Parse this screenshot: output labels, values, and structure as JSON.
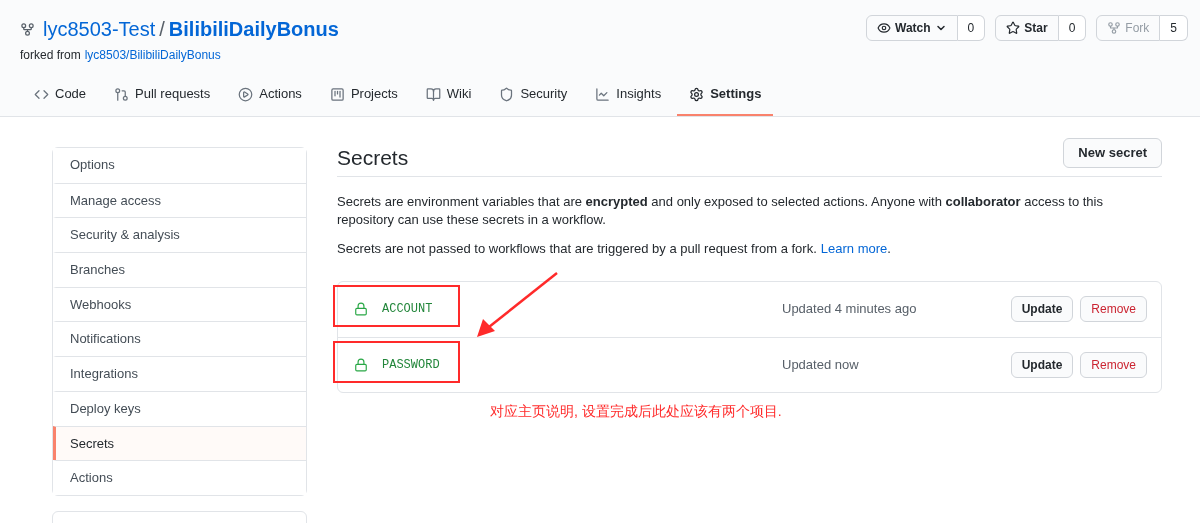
{
  "repo": {
    "owner": "lyc8503-Test",
    "separator": "/",
    "name": "BilibiliDailyBonus",
    "forked_from_label": "forked from",
    "forked_from": "lyc8503/BilibiliDailyBonus"
  },
  "actions": [
    {
      "label": "Watch",
      "count": "0",
      "disabled": false,
      "dropdown": true
    },
    {
      "label": "Star",
      "count": "0",
      "disabled": false,
      "dropdown": false
    },
    {
      "label": "Fork",
      "count": "5",
      "disabled": true,
      "dropdown": false
    }
  ],
  "tabs": [
    {
      "label": "Code",
      "selected": false
    },
    {
      "label": "Pull requests",
      "selected": false
    },
    {
      "label": "Actions",
      "selected": false
    },
    {
      "label": "Projects",
      "selected": false
    },
    {
      "label": "Wiki",
      "selected": false
    },
    {
      "label": "Security",
      "selected": false
    },
    {
      "label": "Insights",
      "selected": false
    },
    {
      "label": "Settings",
      "selected": true
    }
  ],
  "sidebar": {
    "items": [
      {
        "label": "Options",
        "selected": false
      },
      {
        "label": "Manage access",
        "selected": false
      },
      {
        "label": "Security & analysis",
        "selected": false
      },
      {
        "label": "Branches",
        "selected": false
      },
      {
        "label": "Webhooks",
        "selected": false
      },
      {
        "label": "Notifications",
        "selected": false
      },
      {
        "label": "Integrations",
        "selected": false
      },
      {
        "label": "Deploy keys",
        "selected": false
      },
      {
        "label": "Secrets",
        "selected": true
      },
      {
        "label": "Actions",
        "selected": false
      }
    ]
  },
  "main": {
    "title": "Secrets",
    "new_button": "New secret",
    "description": "Secrets are environment variables that are **encrypted** and only exposed to selected actions. Anyone with **collaborator** access to this repository can use these secrets in a workflow.",
    "note": "Secrets are not passed to workflows that are triggered by a pull request from a fork.",
    "learn_more": "Learn more",
    "note_end": ".",
    "secrets": [
      {
        "name": "ACCOUNT",
        "updated": "Updated 4 minutes ago",
        "update_button": "Update",
        "remove_button": "Remove",
        "highlighted": true
      },
      {
        "name": "PASSWORD",
        "updated": "Updated now",
        "update_button": "Update",
        "remove_button": "Remove",
        "highlighted": true
      }
    ]
  },
  "annotation": {
    "text": "对应主页说明, 设置完成后此处应该有两个项目."
  }
}
